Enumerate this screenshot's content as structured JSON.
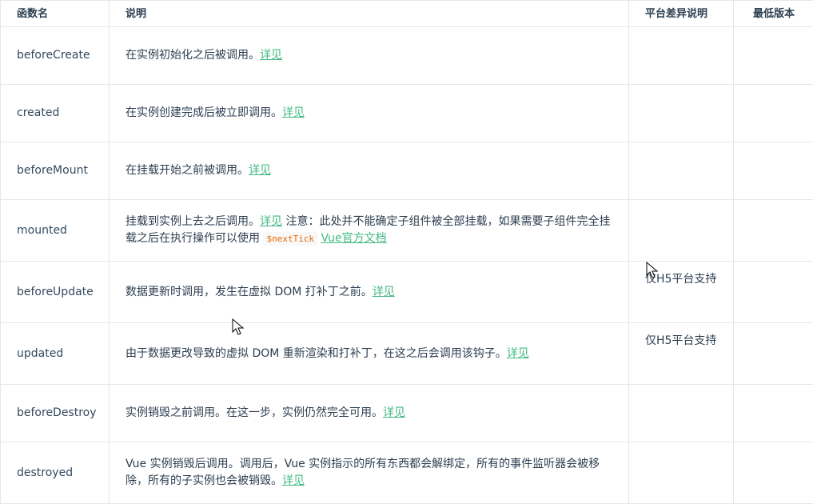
{
  "table": {
    "headers": {
      "name": "函数名",
      "description": "说明",
      "platform": "平台差异说明",
      "version": "最低版本"
    },
    "rows": [
      {
        "name": "beforeCreate",
        "desc_text": "在实例初始化之后被调用。",
        "link": "详见",
        "platform": "",
        "version": ""
      },
      {
        "name": "created",
        "desc_text": "在实例创建完成后被立即调用。",
        "link": "详见",
        "platform": "",
        "version": ""
      },
      {
        "name": "beforeMount",
        "desc_text": "在挂载开始之前被调用。",
        "link": "详见",
        "platform": "",
        "version": ""
      },
      {
        "name": "mounted",
        "desc_text": "挂载到实例上去之后调用。",
        "link": "详见",
        "desc_note": " 注意：此处并不能确定子组件被全部挂载，如果需要子组件完全挂载之后在执行操作可以使用 ",
        "code": "$nextTick",
        "link2": "Vue官方文档",
        "platform": "",
        "version": ""
      },
      {
        "name": "beforeUpdate",
        "desc_text": "数据更新时调用，发生在虚拟 DOM 打补丁之前。",
        "link": "详见",
        "platform": "仅H5平台支持",
        "version": ""
      },
      {
        "name": "updated",
        "desc_text": "由于数据更改导致的虚拟 DOM 重新渲染和打补丁，在这之后会调用该钩子。",
        "link": "详见",
        "platform": "仅H5平台支持",
        "version": ""
      },
      {
        "name": "beforeDestroy",
        "desc_text": "实例销毁之前调用。在这一步，实例仍然完全可用。",
        "link": "详见",
        "platform": "",
        "version": ""
      },
      {
        "name": "destroyed",
        "desc_text": "Vue 实例销毁后调用。调用后，Vue 实例指示的所有东西都会解绑定，所有的事件监听器会被移除，所有的子实例也会被销毁。",
        "link": "详见",
        "platform": "",
        "version": ""
      }
    ]
  },
  "colors": {
    "link": "#42b983",
    "code": "#e96900",
    "border": "#e6e6e6"
  },
  "icons": {
    "cursor": "mouse-pointer-icon"
  }
}
